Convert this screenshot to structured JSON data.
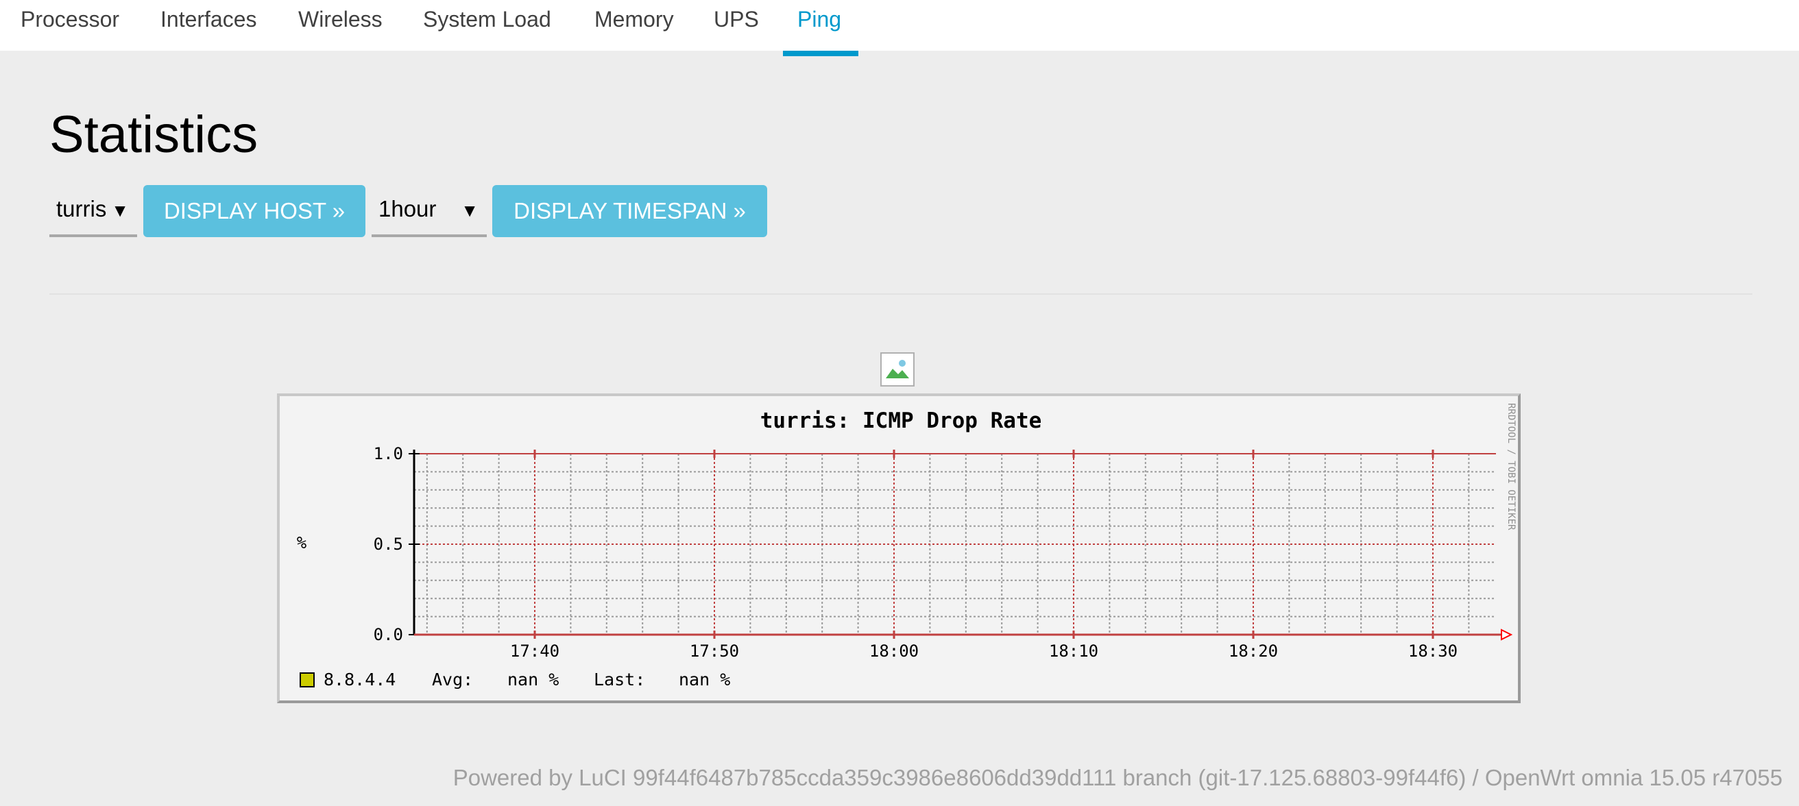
{
  "tabs": [
    {
      "label": "Processor",
      "active": false
    },
    {
      "label": "Interfaces",
      "active": false
    },
    {
      "label": "Wireless",
      "active": false
    },
    {
      "label": "System Load",
      "active": false
    },
    {
      "label": "Memory",
      "active": false
    },
    {
      "label": "UPS",
      "active": false
    },
    {
      "label": "Ping",
      "active": true
    }
  ],
  "page": {
    "title": "Statistics"
  },
  "controls": {
    "host_select": "turris",
    "host_button": "DISPLAY HOST »",
    "timespan_select": "1hour",
    "timespan_button": "DISPLAY TIMESPAN »"
  },
  "colors": {
    "accent": "#0099cc",
    "button": "#5bc0de",
    "series": "#cccc00"
  },
  "chart_data": {
    "type": "line",
    "title": "turris: ICMP Drop Rate",
    "ylabel": "%",
    "side_text": "RRDTOOL / TOBI OETIKER",
    "ylim": [
      0,
      1.0
    ],
    "y_ticks": [
      "0.0",
      "0.5",
      "1.0"
    ],
    "x_ticks": [
      "17:40",
      "17:50",
      "18:00",
      "18:10",
      "18:20",
      "18:30"
    ],
    "grid": true,
    "series": [
      {
        "name": "8.8.4.4",
        "values": [],
        "avg": "nan %",
        "last": "nan %"
      }
    ],
    "legend": {
      "avg_label": "Avg:",
      "last_label": "Last:"
    }
  },
  "footer": "Powered by LuCI 99f44f6487b785ccda359c3986e8606dd39dd111 branch (git-17.125.68803-99f44f6) / OpenWrt omnia 15.05 r47055"
}
